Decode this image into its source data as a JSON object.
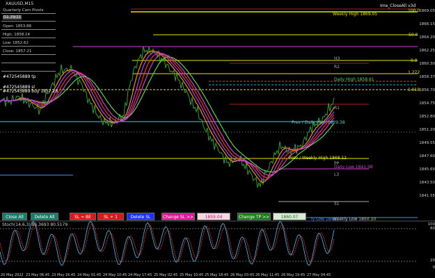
{
  "window": {
    "symbol_label": "XAUUSD,M15",
    "ea_label": "Ime_CloseAll v3d"
  },
  "info_panel": {
    "title": "Quarterly Cam Pivots",
    "title_value": "D1.29/21",
    "rows": [
      "",
      "Open: 1853.88",
      "High: 1858.14",
      "Low: 1852.62",
      "Close: 1857.21",
      "",
      "",
      "",
      ""
    ]
  },
  "buttons": {
    "close_all": "Close All",
    "delete_all": "Delete All",
    "sl_be": "SL = BE",
    "sl_plus1": "SL + 1",
    "delete_sl": "Delete SL",
    "change_sl": "Change SL >>",
    "sl_value": "1859.04",
    "change_tp": "Change TP >>",
    "tp_value": "1860.07"
  },
  "level_labels": {
    "weekly_high": "Weekly High 1869.05",
    "daily_high": "Daily High 1858.61",
    "prev_day_high": "Prev / Daily High 1829.38",
    "prev_weekly_high": "Prev / Weekly High 1868.12",
    "daily_low": "Daily Low 1841.98",
    "weekly_low_a": "ly Low 1843.",
    "weekly_low_b": "Weekly Low 1850.10",
    "r1": "R1",
    "r2": "R2",
    "r3": "R3",
    "pp": "PP",
    "l3": "L3",
    "s1": "S1",
    "h3": "H3"
  },
  "fib_labels": [
    "100.0",
    "50.0",
    "0.0",
    "1.272",
    "1.618"
  ],
  "left_tags": [
    "#472545889 tp",
    "#472545889 sl"
  ],
  "left_edge_tag": "#472545889 buy 1857.28",
  "y_ticks": [
    "1869.05",
    "1866.15",
    "1864.20",
    "1862.25",
    "1860.30",
    "1858.37",
    "1856.70",
    "1854.75",
    "1852.80",
    "1851.20",
    "1849.55",
    "1847.60",
    "1845.65",
    "1843.50",
    "1841.55"
  ],
  "indicator": {
    "label": "Stoch(14,6,3) 86.3693 80.5179",
    "ticks": [
      "100",
      "80",
      "20",
      "0"
    ]
  },
  "x_ticks": [
    "20 May 2022",
    "23 May 06:45",
    "23 May 16:45",
    "24 May 01:45",
    "24 May 10:45",
    "24 May 17:45",
    "25 May 02:45",
    "25 May 10:45",
    "25 May 18:45",
    "26 May 03:45",
    "26 May 11:45",
    "26 May 19:45",
    "27 May 04:45"
  ],
  "colors": {
    "bg": "#000000",
    "price": "#2e8b2e",
    "yellow": "#e6e600",
    "orange": "#ff8c00",
    "red": "#ff2a2a",
    "green": "#55d64a",
    "magenta": "#d040d0",
    "violet": "#b040ff"
  }
}
